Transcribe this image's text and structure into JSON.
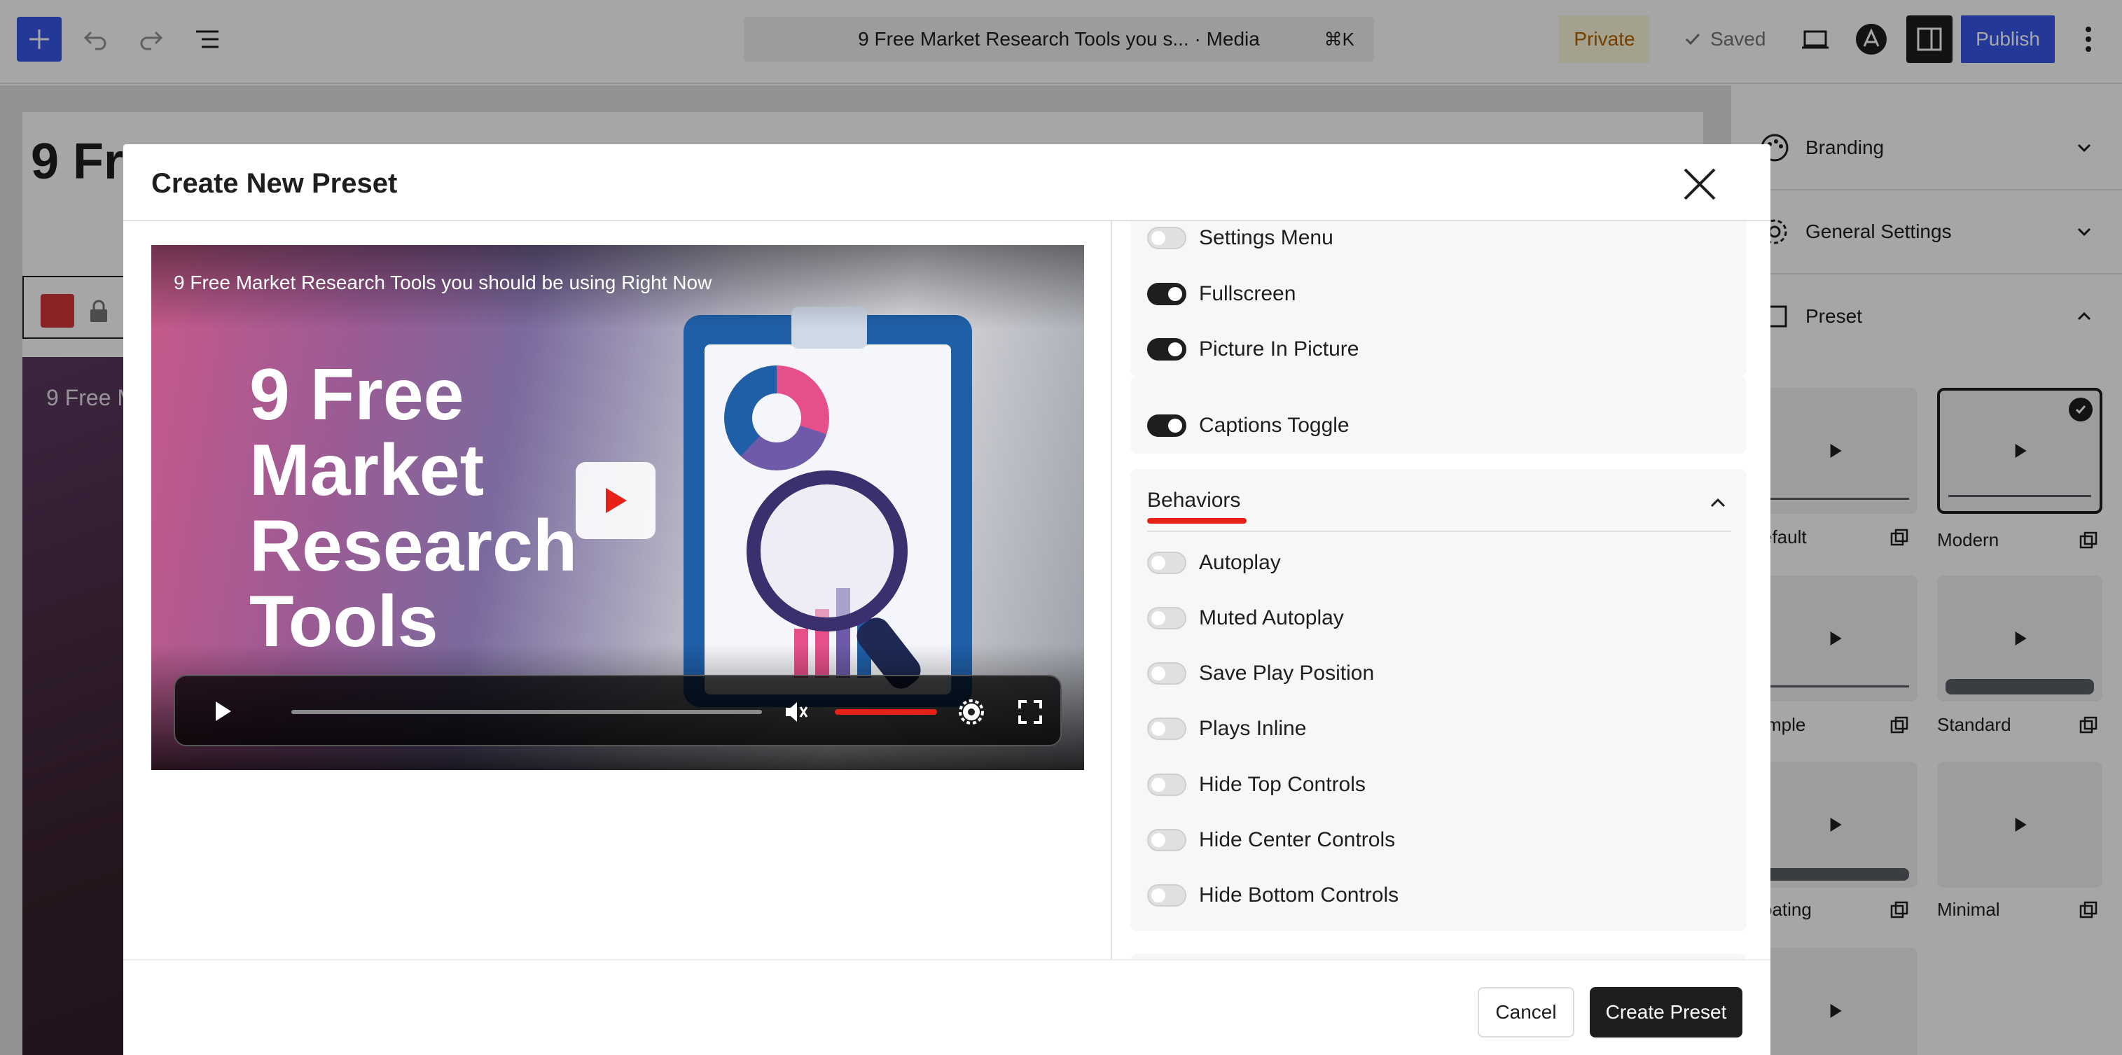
{
  "toolbar": {
    "document_title": "9 Free Market Research Tools you s... · Media",
    "shortcut": "⌘K",
    "private_label": "Private",
    "saved_label": "Saved",
    "publish_label": "Publish",
    "icons": [
      "plus-icon",
      "undo-icon",
      "redo-icon",
      "list-view-icon",
      "view-icon",
      "astra-icon",
      "sidebar-icon",
      "more-icon"
    ]
  },
  "editor": {
    "heading": "9 Fre",
    "video_title": "9 Free M"
  },
  "sidebar": {
    "panels": [
      {
        "label": "Branding",
        "icon": "palette-icon",
        "expanded": false
      },
      {
        "label": "General Settings",
        "icon": "gear-icon",
        "expanded": false
      },
      {
        "label": "Preset",
        "icon": "layout-icon",
        "expanded": true
      }
    ],
    "presets": [
      {
        "name": "efault",
        "selected": false
      },
      {
        "name": "Modern",
        "selected": true
      },
      {
        "name": "mple",
        "selected": false
      },
      {
        "name": "Standard",
        "selected": false
      },
      {
        "name": "oating",
        "selected": false
      },
      {
        "name": "Minimal",
        "selected": false
      }
    ]
  },
  "modal": {
    "title": "Create New Preset",
    "preview": {
      "video_title": "9 Free Market Research Tools you should be using Right Now",
      "headline_lines": [
        "9 Free",
        "Market",
        "Research",
        "Tools"
      ]
    },
    "controls_toggles": [
      {
        "label": "Settings Menu",
        "on": false
      },
      {
        "label": "Fullscreen",
        "on": true
      },
      {
        "label": "Picture In Picture",
        "on": true
      },
      {
        "label": "Captions Toggle",
        "on": true
      }
    ],
    "behaviors": {
      "heading": "Behaviors",
      "toggles": [
        {
          "label": "Autoplay",
          "on": false
        },
        {
          "label": "Muted Autoplay",
          "on": false
        },
        {
          "label": "Save Play Position",
          "on": false
        },
        {
          "label": "Plays Inline",
          "on": false
        },
        {
          "label": "Hide Top Controls",
          "on": false
        },
        {
          "label": "Hide Center Controls",
          "on": false
        },
        {
          "label": "Hide Bottom Controls",
          "on": false
        }
      ]
    },
    "cancel_label": "Cancel",
    "create_label": "Create Preset"
  },
  "colors": {
    "accent": "#3858e9",
    "dark": "#1e1e1e",
    "highlight_red": "#e62117",
    "private_bg": "#fef8dc",
    "private_text": "#b26200"
  }
}
